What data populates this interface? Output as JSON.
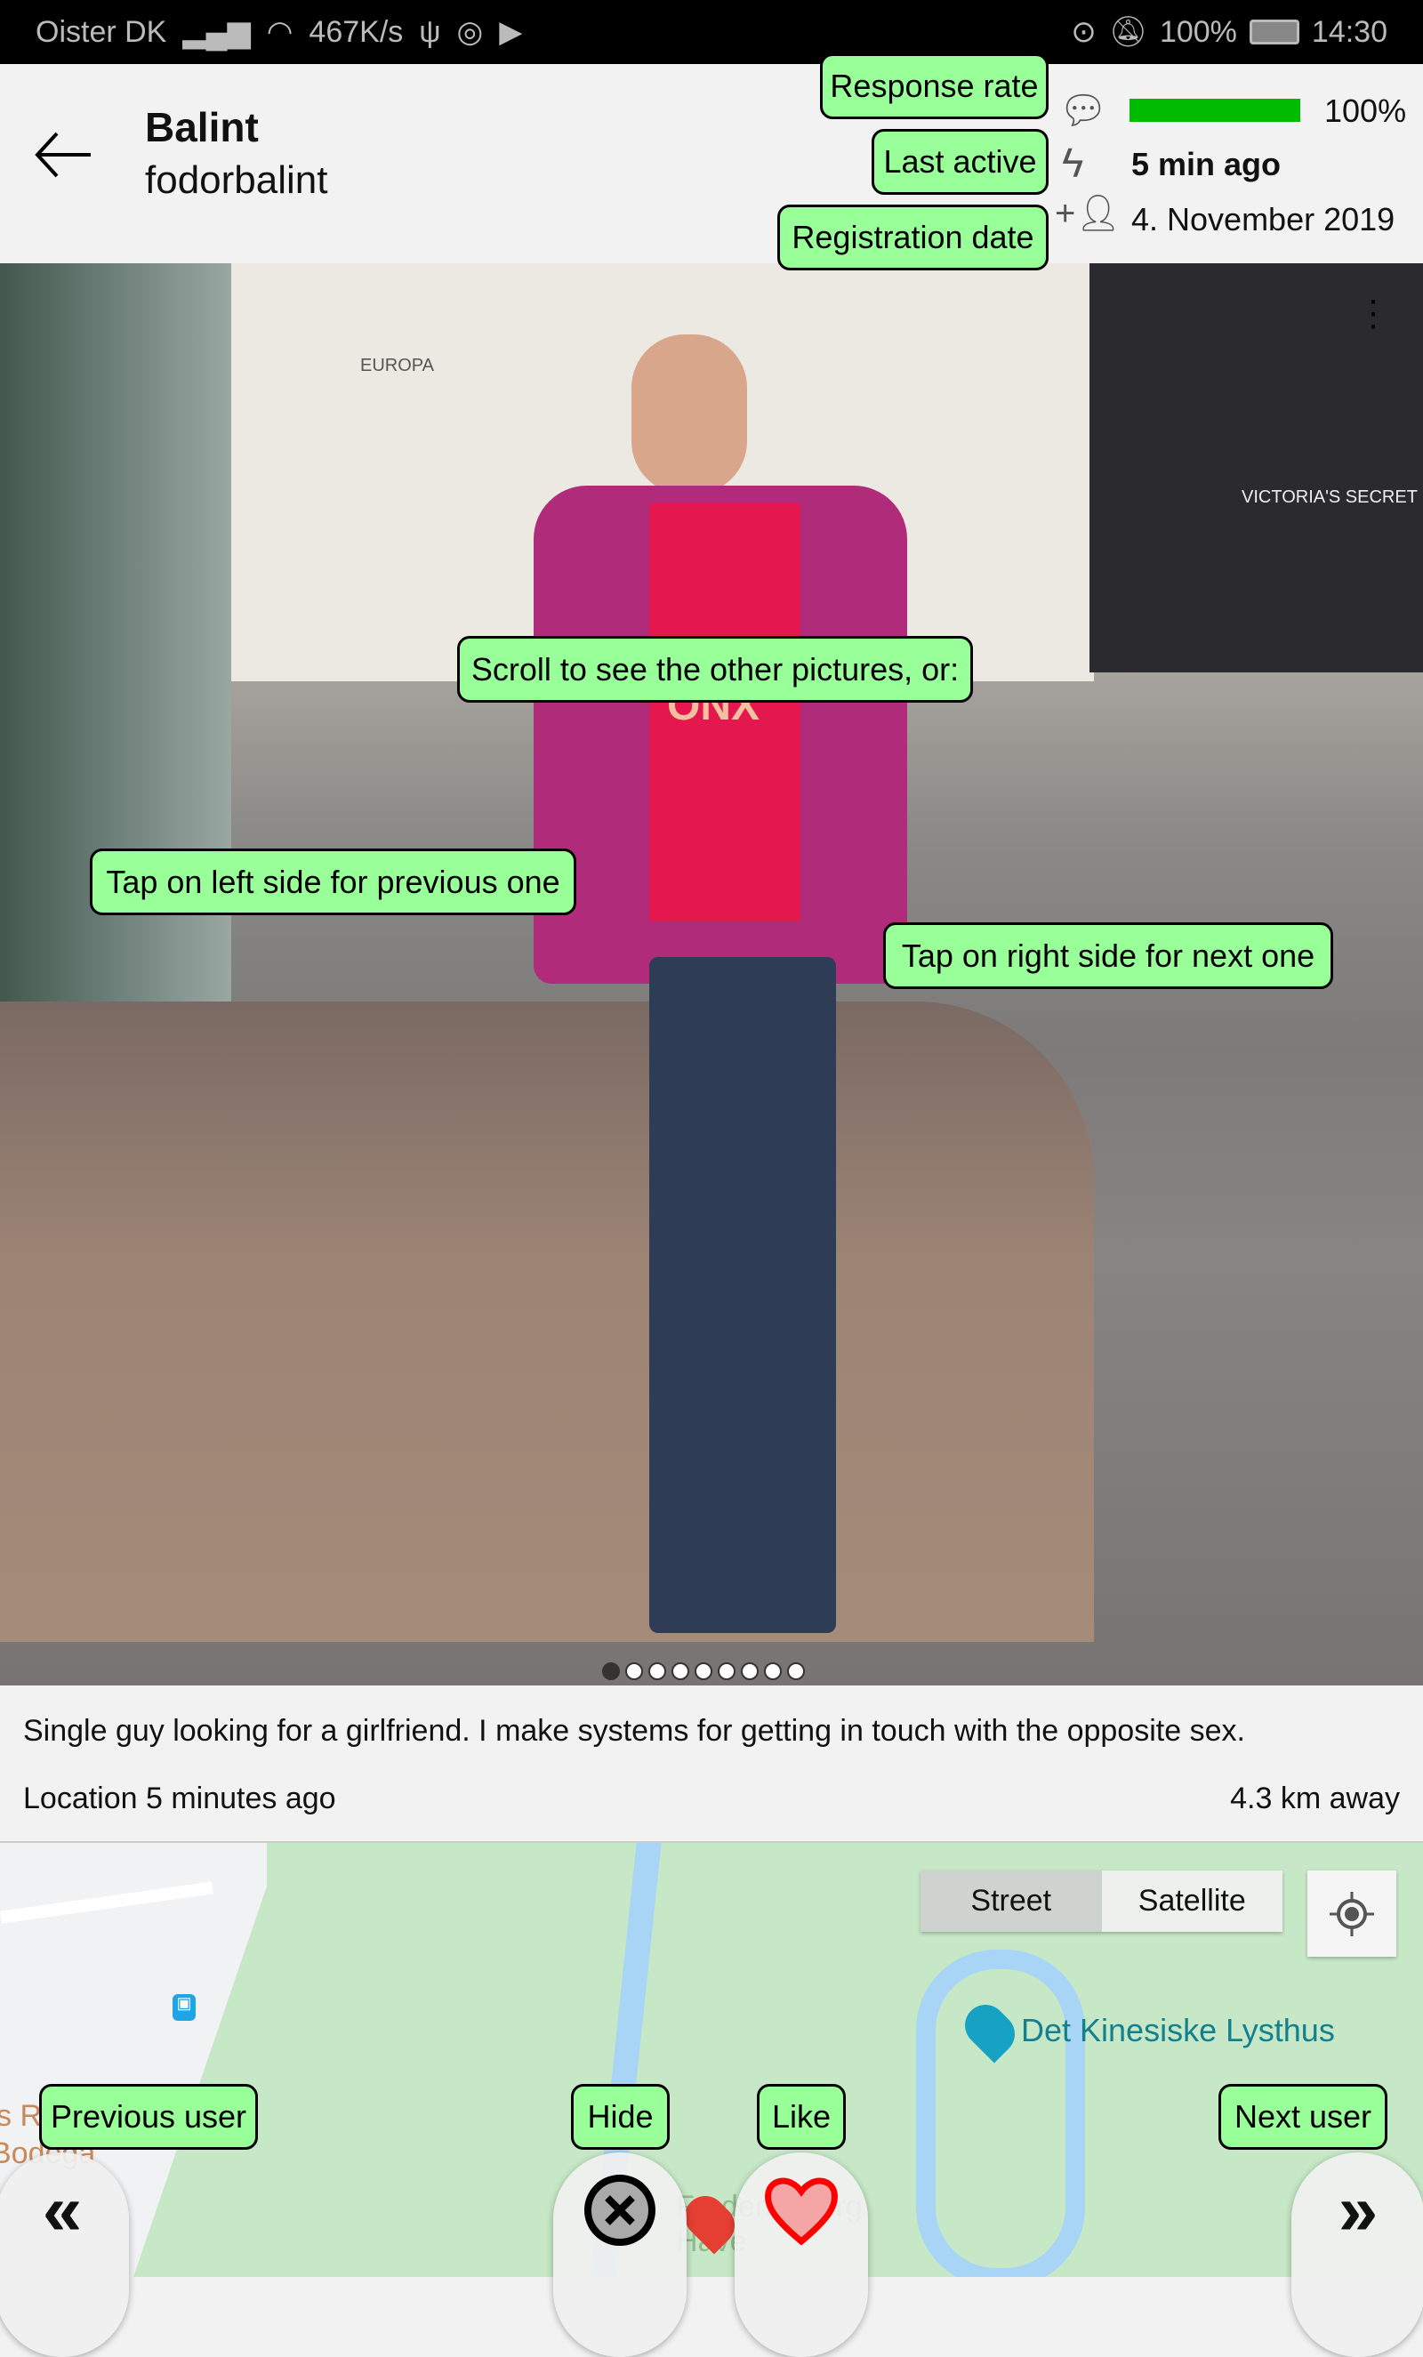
{
  "status_bar": {
    "carrier": "Oister DK",
    "speed": "467K/s",
    "battery": "100%",
    "time": "14:30"
  },
  "header": {
    "name": "Balint",
    "username": "fodorbalint",
    "response_rate_label": "Response rate",
    "response_rate_value": "100%",
    "response_rate_fraction": 1.0,
    "last_active_label": "Last active",
    "last_active_value": "5 min ago",
    "registration_label": "Registration date",
    "registration_value": "4. November 2019"
  },
  "photo": {
    "hint_scroll": "Scroll to see the other pictures, or:",
    "hint_left": "Tap on left side for previous one",
    "hint_right": "Tap on right side for next one",
    "picture_count": 9,
    "current_picture": 1,
    "sign_europa": "EUROPA",
    "sign_victoria": "VICTORIA'S SECRET",
    "shirt_text": "ONX"
  },
  "profile": {
    "description": "Single guy looking for a girlfriend. I make systems for getting in touch with the opposite sex.",
    "location_time": "Location 5 minutes ago",
    "distance": "4.3 km away"
  },
  "map": {
    "street_label": "Street",
    "satellite_label": "Satellite",
    "poi": "Det Kinesiske Lysthus",
    "park": "Frederiksberg Have",
    "edge_label": "Bodega",
    "edge_label2": "s R"
  },
  "actions": {
    "previous_label": "Previous user",
    "hide_label": "Hide",
    "like_label": "Like",
    "next_label": "Next user"
  },
  "colors": {
    "tooltip": "#99ff99",
    "bar": "#00bb00",
    "like": "#ff0000"
  }
}
